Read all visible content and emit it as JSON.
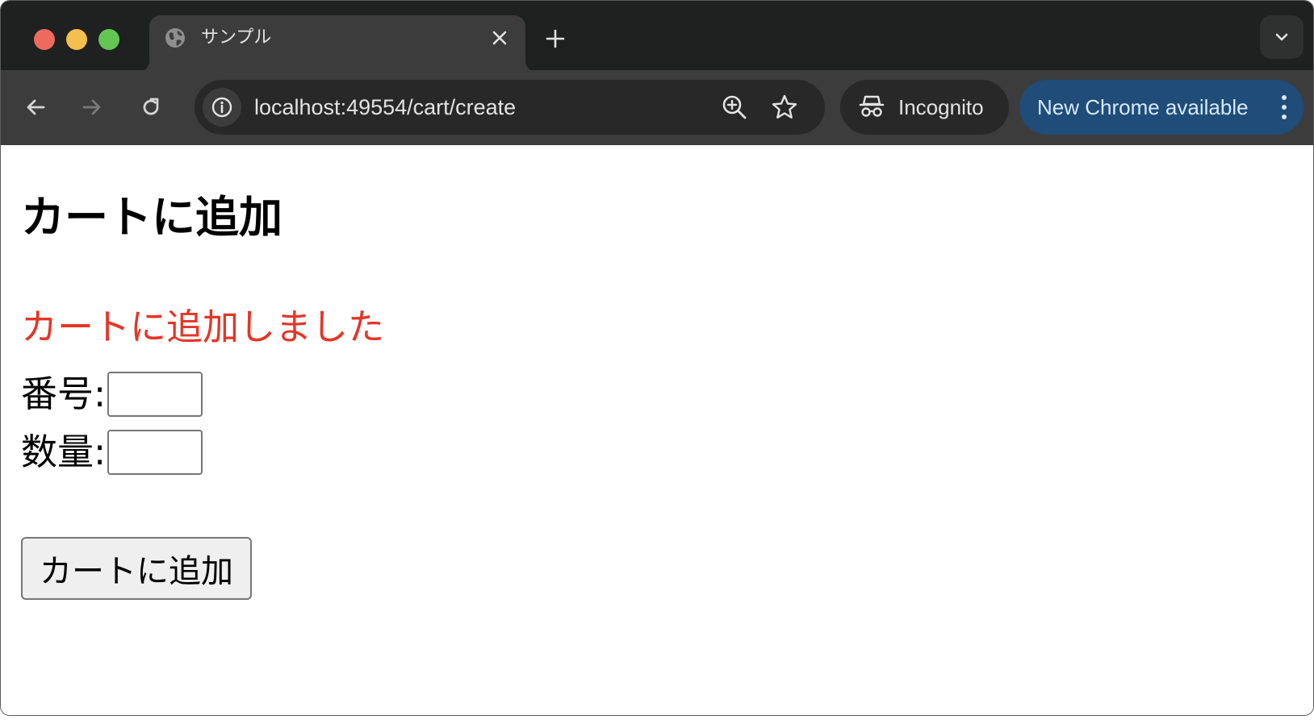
{
  "browser": {
    "tab": {
      "title": "サンプル",
      "favicon": "globe-icon",
      "close": "close-icon"
    },
    "new_tab": "plus-icon",
    "tab_search": "chevron-down-icon",
    "nav": {
      "back": "back-arrow-icon",
      "forward": "forward-arrow-icon",
      "reload": "reload-icon"
    },
    "address_bar": {
      "url": "localhost:49554/cart/create",
      "site_info": "info-icon",
      "zoom": "zoom-in-icon",
      "bookmark": "star-icon"
    },
    "incognito": {
      "label": "Incognito",
      "icon": "incognito-icon"
    },
    "update_button": {
      "label": "New Chrome available",
      "menu": "more-vertical-icon"
    },
    "colors": {
      "titlebar": "#1f2020",
      "toolbar": "#3c3c3c",
      "update_bg": "#1f4c78",
      "update_text": "#d6e9ff"
    }
  },
  "page": {
    "heading": "カートに追加",
    "message": "カートに追加しました",
    "message_color": "#e53527",
    "fields": [
      {
        "label": "番号:",
        "value": ""
      },
      {
        "label": "数量:",
        "value": ""
      }
    ],
    "submit_label": "カートに追加"
  }
}
